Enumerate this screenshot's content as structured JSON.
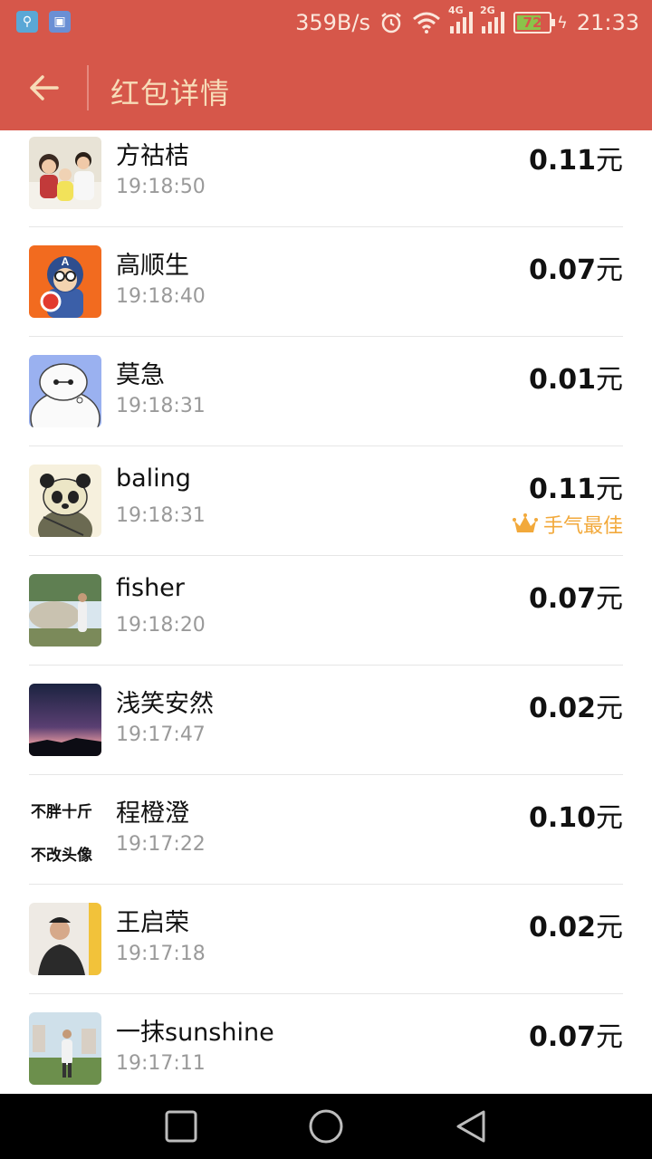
{
  "status_bar": {
    "net_speed": "359B/s",
    "sig1_tag": "4G",
    "sig2_tag": "2G",
    "battery": "72",
    "time": "21:33",
    "icons": [
      "usb-icon",
      "image-icon",
      "alarm-icon",
      "wifi-icon",
      "signal-icon",
      "signal-icon",
      "battery-icon",
      "charging-icon"
    ]
  },
  "app_bar": {
    "title": "红包详情",
    "back_icon": "arrow-left-icon"
  },
  "records": [
    {
      "name": "方祜桔",
      "time": "19:18:50",
      "amount": "0.11",
      "unit": "元"
    },
    {
      "name": "高顺生",
      "time": "19:18:40",
      "amount": "0.07",
      "unit": "元"
    },
    {
      "name": "莫急",
      "time": "19:18:31",
      "amount": "0.01",
      "unit": "元"
    },
    {
      "name": "baling",
      "time": "19:18:31",
      "amount": "0.11",
      "unit": "元",
      "best": "手气最佳"
    },
    {
      "name": "fisher",
      "time": "19:18:20",
      "amount": "0.07",
      "unit": "元"
    },
    {
      "name": "浅笑安然",
      "time": "19:17:47",
      "amount": "0.02",
      "unit": "元"
    },
    {
      "name": "程橙澄",
      "time": "19:17:22",
      "amount": "0.10",
      "unit": "元",
      "avatar_text": [
        "不胖十斤",
        "不改头像"
      ]
    },
    {
      "name": "王启荣",
      "time": "19:17:18",
      "amount": "0.02",
      "unit": "元"
    },
    {
      "name": "一抹sunshine",
      "time": "19:17:11",
      "amount": "0.07",
      "unit": "元"
    }
  ],
  "colors": {
    "header": "#d6574a",
    "header_text": "#f7dcb8",
    "best_badge": "#f2a93b"
  },
  "nav_bar": {
    "icons": [
      "recent-apps-icon",
      "home-icon",
      "back-icon"
    ]
  }
}
